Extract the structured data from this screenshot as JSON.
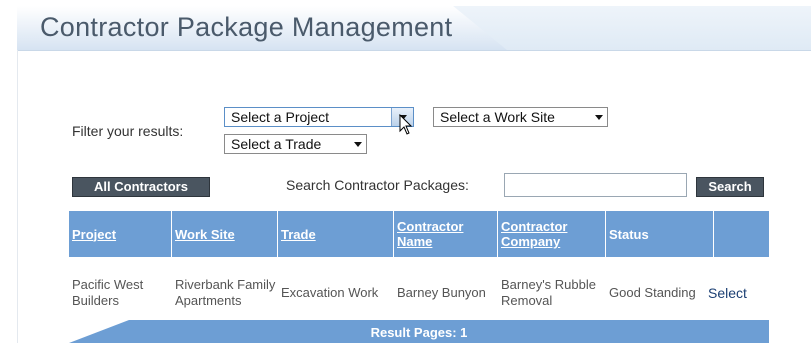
{
  "header": {
    "title": "Contractor Package Management"
  },
  "filters": {
    "label": "Filter your results:",
    "project": "Select a Project",
    "work_site": "Select a Work Site",
    "trade": "Select a Trade"
  },
  "toolbar": {
    "all_contractors": "All Contractors",
    "search_label": "Search Contractor Packages:",
    "search_value": "",
    "search_button": "Search"
  },
  "table": {
    "columns": [
      "Project",
      "Work Site",
      "Trade",
      "Contractor Name",
      "Contractor Company",
      "Status",
      ""
    ],
    "rows": [
      {
        "project": "Pacific West Builders",
        "work_site": "Riverbank Family Apartments",
        "trade": "Excavation Work",
        "contractor_name": "Barney Bunyon",
        "contractor_company": "Barney's Rubble Removal",
        "status": "Good Standing",
        "action": "Select"
      }
    ]
  },
  "pagination": {
    "label": "Result Pages: 1"
  },
  "colors": {
    "table_header": "#6d9ed4",
    "button_dark": "#4a5560",
    "title": "#4a5a6b"
  }
}
